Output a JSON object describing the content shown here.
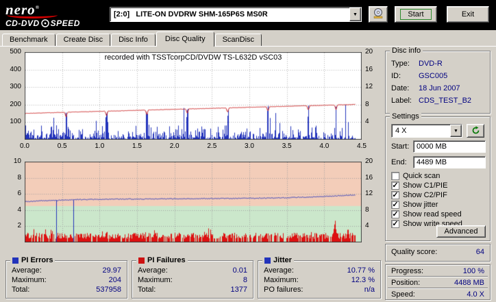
{
  "colors": {
    "window_bg": "#d4d0c8",
    "navy": "#000080",
    "chart_blue": "#2233bb",
    "chart_red": "#cc2222",
    "bar_red": "#dd1111",
    "zone_good": "#cbe7cb",
    "zone_bad": "#f3cdb9"
  },
  "titlebar": {
    "logo_line1": "nero",
    "logo_reg": "®",
    "logo_line2a": "CD-DVD",
    "logo_line2b": "SPEED",
    "drive_selector": "[2:0]   LITE-ON DVDRW SHM-165P6S MS0R",
    "start_button": "Start",
    "exit_button": "Exit"
  },
  "tabs": [
    {
      "label": "Benchmark",
      "active": false
    },
    {
      "label": "Create Disc",
      "active": false
    },
    {
      "label": "Disc Info",
      "active": false
    },
    {
      "label": "Disc Quality",
      "active": true
    },
    {
      "label": "ScanDisc",
      "active": false
    }
  ],
  "chart_data": [
    {
      "type": "line",
      "title": "recorded with TSSTcorpCD/DVDW TS-L632D vSC03",
      "x_range": [
        0,
        4.5
      ],
      "x_ticks": [
        "0.0",
        "0.5",
        "1.0",
        "1.5",
        "2.0",
        "2.5",
        "3.0",
        "3.5",
        "4.0",
        "4.5"
      ],
      "left_axis": {
        "max": 500,
        "ticks": [
          "500",
          "400",
          "300",
          "200",
          "100"
        ]
      },
      "right_axis": {
        "max": 20,
        "ticks": [
          "20",
          "16",
          "12",
          "8",
          "4"
        ]
      },
      "grid": true,
      "series": [
        {
          "name": "PI Errors",
          "style": "noise",
          "color": "#2233bb",
          "axis": "left",
          "average": 29.97,
          "maximum": 204,
          "seed": 1337,
          "base_mean": 26,
          "start_boost": 32,
          "boost_decay": 0.6,
          "data_end": 4.42,
          "spikes": [
            0.55,
            1.09,
            1.63,
            2.17,
            2.71,
            3.25,
            3.79,
            4.16
          ]
        },
        {
          "name": "Write speed",
          "style": "line",
          "color": "#cc2222",
          "axis": "right",
          "start": 6.0,
          "end": 8.05,
          "data_end": 4.42,
          "dips": [
            0.55,
            1.09,
            1.63,
            2.17,
            2.71,
            3.25,
            3.79,
            4.16
          ],
          "dip_depth": 1.1,
          "noise_seed": 7
        }
      ]
    },
    {
      "type": "mixed",
      "x_range": [
        0,
        4.5
      ],
      "left_axis": {
        "max": 10,
        "ticks": [
          "10",
          "8",
          "6",
          "4",
          "2"
        ]
      },
      "right_axis": {
        "max": 20,
        "ticks": [
          "20",
          "16",
          "12",
          "8",
          "4"
        ]
      },
      "grid": true,
      "zones": {
        "bad_color": "#f3cdb9",
        "good_color": "#cbe7cb",
        "boundary_left": 4.5
      },
      "series": [
        {
          "name": "PI Failures",
          "style": "bar",
          "color": "#dd1111",
          "axis": "left",
          "average": 0.01,
          "maximum": 8,
          "total": 1377,
          "seed": 4242,
          "base": 0.45,
          "spread": 0.75,
          "density": 0.82,
          "data_end": 4.42,
          "cluster_x": 4.15,
          "cluster_peak": 2.9
        },
        {
          "name": "Jitter",
          "style": "line",
          "color": "#2233bb",
          "axis": "right",
          "average_pct": 10.77,
          "maximum_pct": 12.3,
          "seed": 99,
          "noise": 0.05,
          "data_end": 4.42,
          "points": [
            [
              0,
              5.05
            ],
            [
              0.2,
              5.15
            ],
            [
              0.42,
              5.2
            ],
            [
              0.7,
              5.3
            ],
            [
              1.2,
              5.35
            ],
            [
              2.0,
              5.4
            ],
            [
              2.8,
              5.45
            ],
            [
              3.4,
              5.5
            ],
            [
              3.9,
              5.65
            ],
            [
              4.25,
              5.8
            ],
            [
              4.42,
              5.85
            ]
          ],
          "drops": [
            0.42,
            0.65
          ]
        }
      ]
    }
  ],
  "disc_info": {
    "title": "Disc info",
    "rows": [
      {
        "label": "Type:",
        "value": "DVD-R"
      },
      {
        "label": "ID:",
        "value": "GSC005"
      },
      {
        "label": "Date:",
        "value": "18 Jun 2007"
      },
      {
        "label": "Label:",
        "value": "CDS_TEST_B2"
      }
    ]
  },
  "settings": {
    "title": "Settings",
    "speed_value": "4 X",
    "start_label": "Start:",
    "start_value": "0000 MB",
    "end_label": "End:",
    "end_value": "4489 MB",
    "checkboxes": [
      {
        "label": "Quick scan",
        "checked": false
      },
      {
        "label": "Show C1/PIE",
        "checked": true
      },
      {
        "label": "Show C2/PIF",
        "checked": true
      },
      {
        "label": "Show jitter",
        "checked": true
      },
      {
        "label": "Show read speed",
        "checked": true
      },
      {
        "label": "Show write speed",
        "checked": true
      }
    ],
    "advanced_button": "Advanced"
  },
  "quality_score": {
    "label": "Quality score:",
    "value": "64"
  },
  "stat_boxes": [
    {
      "title": "PI Errors",
      "marker_color": "#2233bb",
      "rows": [
        [
          "Average:",
          "29.97"
        ],
        [
          "Maximum:",
          "204"
        ],
        [
          "Total:",
          "537958"
        ]
      ]
    },
    {
      "title": "PI Failures",
      "marker_color": "#cc1111",
      "rows": [
        [
          "Average:",
          "0.01"
        ],
        [
          "Maximum:",
          "8"
        ],
        [
          "Total:",
          "1377"
        ]
      ]
    },
    {
      "title": "Jitter",
      "marker_color": "#2233bb",
      "rows": [
        [
          "Average:",
          "10.77 %"
        ],
        [
          "Maximum:",
          "12.3 %"
        ],
        [
          "PO failures:",
          "n/a"
        ]
      ]
    }
  ],
  "status_rows": [
    {
      "label": "Progress:",
      "value": "100 %"
    },
    {
      "label": "Position:",
      "value": "4488 MB"
    },
    {
      "label": "Speed:",
      "value": "4.0 X"
    }
  ]
}
